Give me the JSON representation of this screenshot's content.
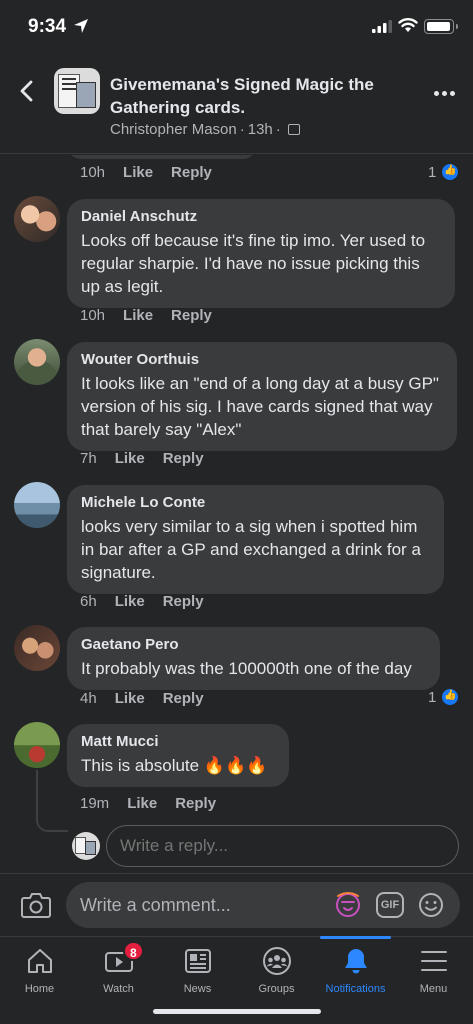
{
  "status_bar": {
    "time": "9:34"
  },
  "header": {
    "title": "Givememana's Signed Magic the Gathering cards.",
    "author": "Christopher Mason",
    "age": "13h",
    "separator": "·"
  },
  "top_actions": {
    "time": "10h",
    "like": "Like",
    "reply": "Reply",
    "reaction_count": "1"
  },
  "comments": [
    {
      "name": "Daniel Anschutz",
      "text": "Looks off because it's fine tip imo. Yer used to regular sharpie. I'd have no issue picking this up as legit.",
      "time": "10h",
      "like": "Like",
      "reply": "Reply"
    },
    {
      "name": "Wouter Oorthuis",
      "text": "It looks like an \"end of a long day at a busy GP\" version of his sig. I have cards signed that way that barely say \"Alex\"",
      "time": "7h",
      "like": "Like",
      "reply": "Reply"
    },
    {
      "name": "Michele Lo Conte",
      "text": "looks very similar to a sig when i spotted him in bar after a GP and exchanged a drink for a signature.",
      "time": "6h",
      "like": "Like",
      "reply": "Reply"
    },
    {
      "name": "Gaetano Pero",
      "text": "It probably was the 100000th one of the day",
      "time": "4h",
      "like": "Like",
      "reply": "Reply",
      "reaction_count": "1"
    },
    {
      "name": "Matt Mucci",
      "text": "This is absolute 🔥🔥🔥",
      "time": "19m",
      "like": "Like",
      "reply": "Reply"
    }
  ],
  "reply_box": {
    "placeholder": "Write a reply..."
  },
  "composer": {
    "placeholder": "Write a comment...",
    "gif_label": "GIF"
  },
  "tabs": [
    {
      "label": "Home",
      "icon": "home-icon"
    },
    {
      "label": "Watch",
      "icon": "watch-icon",
      "badge": "8"
    },
    {
      "label": "News",
      "icon": "news-icon"
    },
    {
      "label": "Groups",
      "icon": "groups-icon"
    },
    {
      "label": "Notifications",
      "icon": "bell-icon",
      "active": true
    },
    {
      "label": "Menu",
      "icon": "menu-icon"
    }
  ],
  "colors": {
    "background": "#242526",
    "bubble": "#3a3b3c",
    "accent": "#2d88ff",
    "badge": "#e41e3f",
    "text": "#e4e6eb",
    "muted": "#b0b3b8"
  }
}
